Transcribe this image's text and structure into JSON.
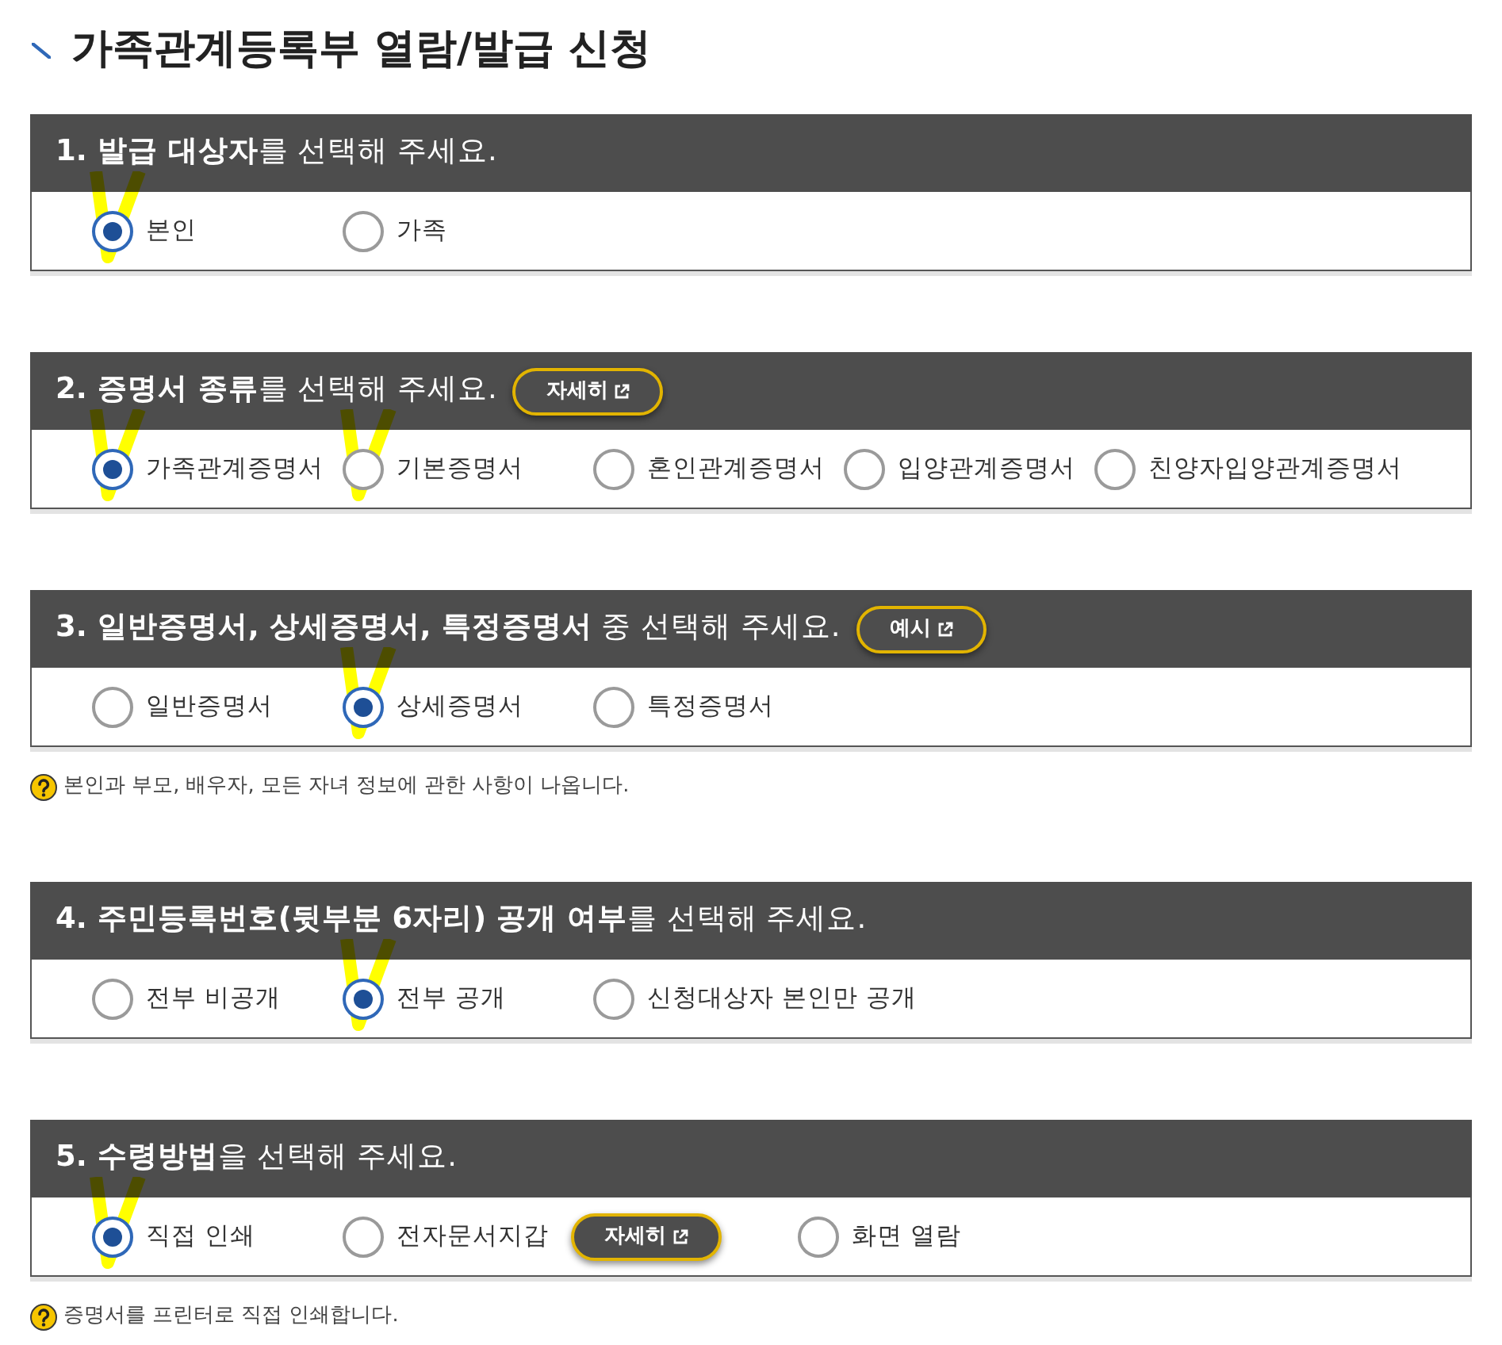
{
  "page": {
    "title": "가족관계등록부 열람/발급 신청"
  },
  "sections": [
    {
      "heading": "**1. 발급 대상자**를 선택해 주세요.",
      "options": [
        {
          "label": "본인",
          "selected": true,
          "marked": true
        },
        {
          "label": "가족",
          "selected": false,
          "marked": false
        }
      ]
    },
    {
      "heading": "**2. 증명서 종류**를 선택해 주세요.",
      "header_button": {
        "label": "자세히"
      },
      "options": [
        {
          "label": "가족관계증명서",
          "selected": true,
          "marked": true
        },
        {
          "label": "기본증명서",
          "selected": false,
          "marked": true
        },
        {
          "label": "혼인관계증명서",
          "selected": false,
          "marked": false
        },
        {
          "label": "입양관계증명서",
          "selected": false,
          "marked": false
        },
        {
          "label": "친양자입양관계증명서",
          "selected": false,
          "marked": false
        }
      ]
    },
    {
      "heading": "**3. 일반증명서, 상세증명서, 특정증명서** 중 선택해 주세요.",
      "header_button": {
        "label": "예시"
      },
      "options": [
        {
          "label": "일반증명서",
          "selected": false,
          "marked": false
        },
        {
          "label": "상세증명서",
          "selected": true,
          "marked": true
        },
        {
          "label": "특정증명서",
          "selected": false,
          "marked": false
        }
      ],
      "note": "본인과 부모, 배우자, 모든 자녀 정보에 관한 사항이 나옵니다."
    },
    {
      "heading": "**4. 주민등록번호(뒷부분 6자리) 공개 여부**를 선택해 주세요.",
      "options": [
        {
          "label": "전부 비공개",
          "selected": false,
          "marked": false
        },
        {
          "label": "전부 공개",
          "selected": true,
          "marked": true
        },
        {
          "label": "신청대상자 본인만 공개",
          "selected": false,
          "marked": false
        }
      ]
    },
    {
      "heading": "**5. 수령방법**을 선택해 주세요.",
      "options": [
        {
          "label": "직접 인쇄",
          "selected": true,
          "marked": true
        },
        {
          "label": "전자문서지갑",
          "selected": false,
          "marked": false,
          "button": {
            "label": "자세히"
          }
        },
        {
          "label": "화면 열람",
          "selected": false,
          "marked": false
        }
      ],
      "note": "증명서를 프린터로 직접 인쇄합니다."
    }
  ]
}
